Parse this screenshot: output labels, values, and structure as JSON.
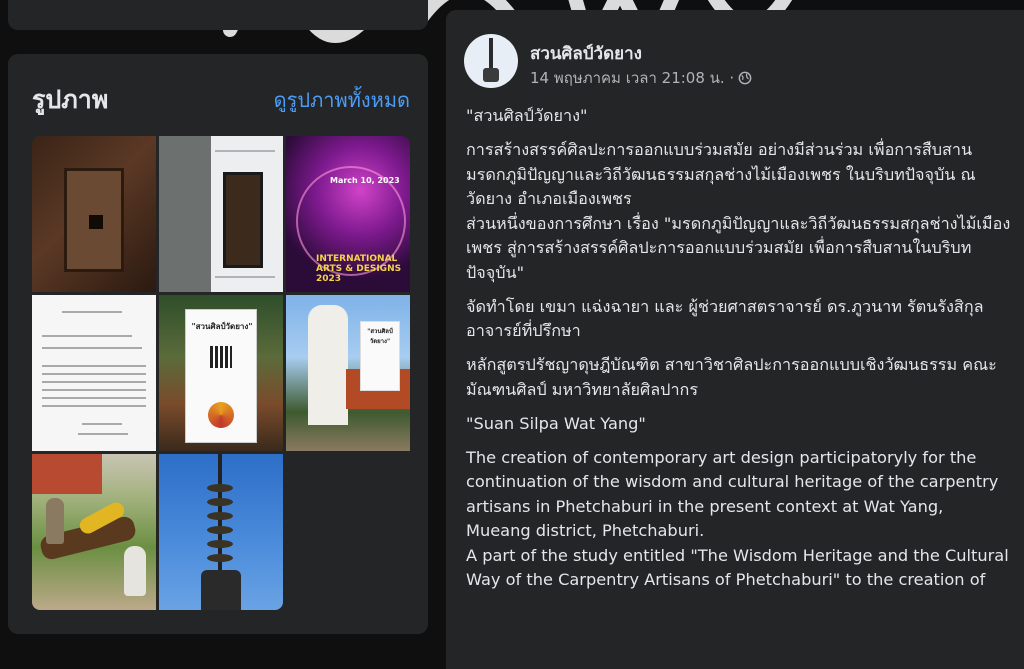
{
  "photos": {
    "title": "รูปภาพ",
    "see_all": "ดูรูปภาพทั้งหมด",
    "items": [
      {
        "name": "photo-wood-door"
      },
      {
        "name": "photo-document-door"
      },
      {
        "name": "photo-event-poster",
        "poster_line": "March 10, 2023",
        "poster_big": "INTERNATIONAL ARTS & DESIGNS 2023"
      },
      {
        "name": "photo-official-letter"
      },
      {
        "name": "photo-display-stand",
        "stand_title": "\"สวนศิลป์วัดยาง\""
      },
      {
        "name": "photo-white-temple",
        "sign_title": "\"สวนศิลป์วัดยาง\""
      },
      {
        "name": "photo-sculpture-men"
      },
      {
        "name": "photo-stacked-pole"
      }
    ]
  },
  "post": {
    "author": "สวนศิลป์วัดยาง",
    "timestamp": "14 พฤษภาคม เวลา 21:08 น. ·",
    "privacy_icon": "globe-icon",
    "paragraphs": [
      "\"สวนศิลป์วัดยาง\"",
      "การสร้างสรรค์ศิลปะการออกแบบร่วมสมัย อย่างมีส่วนร่วม เพื่อการสืบสานมรดกภูมิปัญญาและวิถีวัฒนธรรมสกุลช่างไม้เมืองเพชร ในบริบทปัจจุบัน ณ วัดยาง อำเภอเมืองเพชร\nส่วนหนึ่งของการศึกษา เรื่อง \"มรดกภูมิปัญญาและวิถีวัฒนธรรมสกุลช่างไม้เมืองเพชร สู่การสร้างสรรค์ศิลปะการออกแบบร่วมสมัย เพื่อการสืบสานในบริบทปัจจุบัน\"",
      "จัดทำโดย เขมา แฉ่งฉายา และ ผู้ช่วยศาสตราจารย์ ดร.ภูวนาท รัตนรังสิกุล อาจารย์ที่ปรึกษา",
      "หลักสูตรปรัชญาดุษฎีบัณฑิต สาขาวิชาศิลปะการออกแบบเชิงวัฒนธรรม คณะมัณฑนศิลป์ มหาวิทยาลัยศิลปากร",
      "\"Suan Silpa Wat Yang\"",
      "The creation of contemporary art design participatoryly for the continuation of the wisdom and cultural heritage of the carpentry artisans in Phetchaburi in the present context at Wat Yang, Mueang district, Phetchaburi.\nA part of the study entitled \"The Wisdom Heritage and the Cultural Way of the Carpentry Artisans of Phetchaburi\" to the creation of"
    ]
  },
  "colors": {
    "background": "#0f0f10",
    "card": "#242526",
    "link": "#4c9df8",
    "text": "#e4e6eb",
    "muted": "#b0b3b8"
  }
}
